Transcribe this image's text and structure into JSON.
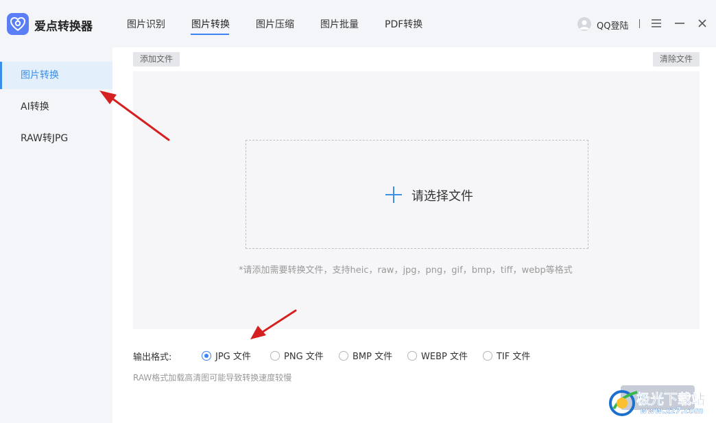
{
  "app": {
    "title": "爱点转换器"
  },
  "nav": {
    "tabs": [
      {
        "label": "图片识别"
      },
      {
        "label": "图片转换",
        "active": true
      },
      {
        "label": "图片压缩"
      },
      {
        "label": "图片批量"
      },
      {
        "label": "PDF转换"
      }
    ]
  },
  "header": {
    "login_label": "QQ登陆"
  },
  "sidebar": {
    "items": [
      {
        "label": "图片转换",
        "active": true
      },
      {
        "label": "AI转换"
      },
      {
        "label": "RAW转JPG"
      }
    ]
  },
  "toolbar": {
    "add_file": "添加文件",
    "clear_file": "清除文件"
  },
  "dropzone": {
    "label": "请选择文件",
    "hint": "*请添加需要转换文件，支持heic，raw，jpg，png，gif，bmp，tiff，webp等格式"
  },
  "output": {
    "label": "输出格式:",
    "options": [
      {
        "label": "JPG 文件",
        "checked": true
      },
      {
        "label": "PNG 文件"
      },
      {
        "label": "BMP 文件"
      },
      {
        "label": "WEBP 文件"
      },
      {
        "label": "TIF 文件"
      }
    ],
    "note": "RAW格式加载高清图可能导致转换速度较慢"
  },
  "watermark": {
    "line1": "极光下载站",
    "line2": "www.xz7.com"
  },
  "colors": {
    "accent": "#3b82f6",
    "sidebar_active_bg": "#e3f0fc",
    "arrow": "#d42020"
  }
}
